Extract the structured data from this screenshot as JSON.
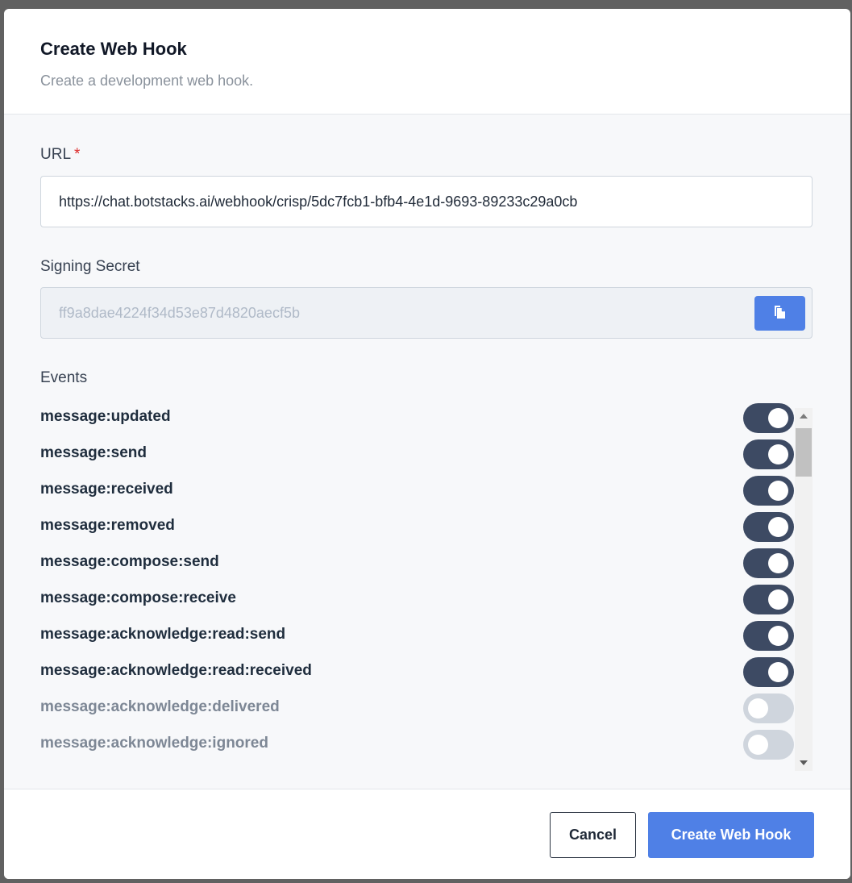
{
  "header": {
    "title": "Create Web Hook",
    "subtitle": "Create a development web hook."
  },
  "url_field": {
    "label": "URL",
    "required_mark": "*",
    "value": "https://chat.botstacks.ai/webhook/crisp/5dc7fcb1-bfb4-4e1d-9693-89233c29a0cb"
  },
  "secret_field": {
    "label": "Signing Secret",
    "value": "ff9a8dae4224f34d53e87d4820aecf5b",
    "copy_icon": "copy-icon"
  },
  "events": {
    "label": "Events",
    "items": [
      {
        "name": "message:updated",
        "enabled": true
      },
      {
        "name": "message:send",
        "enabled": true
      },
      {
        "name": "message:received",
        "enabled": true
      },
      {
        "name": "message:removed",
        "enabled": true
      },
      {
        "name": "message:compose:send",
        "enabled": true
      },
      {
        "name": "message:compose:receive",
        "enabled": true
      },
      {
        "name": "message:acknowledge:read:send",
        "enabled": true
      },
      {
        "name": "message:acknowledge:read:received",
        "enabled": true
      },
      {
        "name": "message:acknowledge:delivered",
        "enabled": false
      },
      {
        "name": "message:acknowledge:ignored",
        "enabled": false
      }
    ]
  },
  "footer": {
    "cancel_label": "Cancel",
    "create_label": "Create Web Hook"
  },
  "colors": {
    "primary": "#4f80e6",
    "toggle_on": "#3d4a63",
    "toggle_off": "#cfd5dd",
    "required": "#dc2626"
  }
}
